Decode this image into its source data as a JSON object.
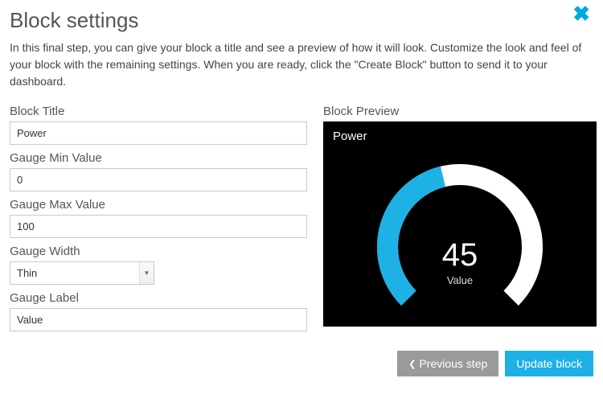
{
  "header": {
    "title": "Block settings",
    "intro": "In this final step, you can give your block a title and see a preview of how it will look. Customize the look and feel of your block with the remaining settings. When you are ready, click the \"Create Block\" button to send it to your dashboard."
  },
  "form": {
    "block_title_label": "Block Title",
    "block_title_value": "Power",
    "gauge_min_label": "Gauge Min Value",
    "gauge_min_value": "0",
    "gauge_max_label": "Gauge Max Value",
    "gauge_max_value": "100",
    "gauge_width_label": "Gauge Width",
    "gauge_width_value": "Thin",
    "gauge_label_label": "Gauge Label",
    "gauge_label_value": "Value"
  },
  "preview": {
    "section_label": "Block Preview",
    "title": "Power",
    "value": "45",
    "unit_label": "Value",
    "gauge": {
      "min": 0,
      "max": 100,
      "current": 45,
      "track_color": "#ffffff",
      "fill_color": "#1db1e6",
      "background": "#000000"
    }
  },
  "footer": {
    "previous_label": "Previous step",
    "update_label": "Update block"
  },
  "chart_data": {
    "type": "gauge",
    "title": "Power",
    "value": 45,
    "min": 0,
    "max": 100,
    "label": "Value"
  }
}
